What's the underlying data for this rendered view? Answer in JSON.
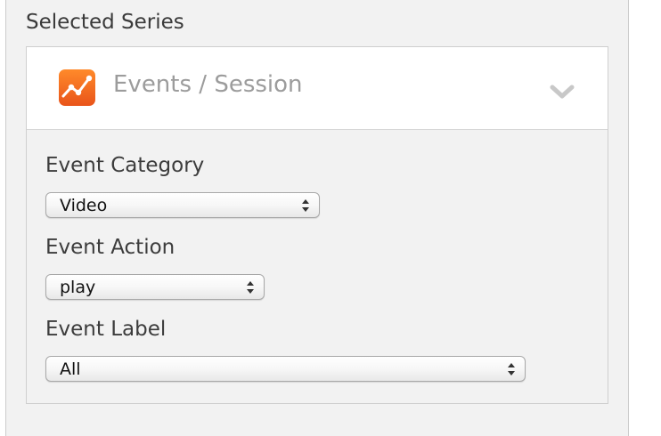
{
  "panel": {
    "title": "Selected Series"
  },
  "series": {
    "icon": "google-analytics-icon",
    "icon_color": "#f26b1d",
    "name": "Events / Session",
    "toggle_icon": "chevron-down-icon"
  },
  "fields": [
    {
      "label": "Event Category",
      "value": "Video"
    },
    {
      "label": "Event Action",
      "value": "play"
    },
    {
      "label": "Event Label",
      "value": "All"
    }
  ],
  "colors": {
    "panel_background": "#f2f2f2",
    "header_background": "#ffffff",
    "series_name_text": "#9c9c9c"
  }
}
